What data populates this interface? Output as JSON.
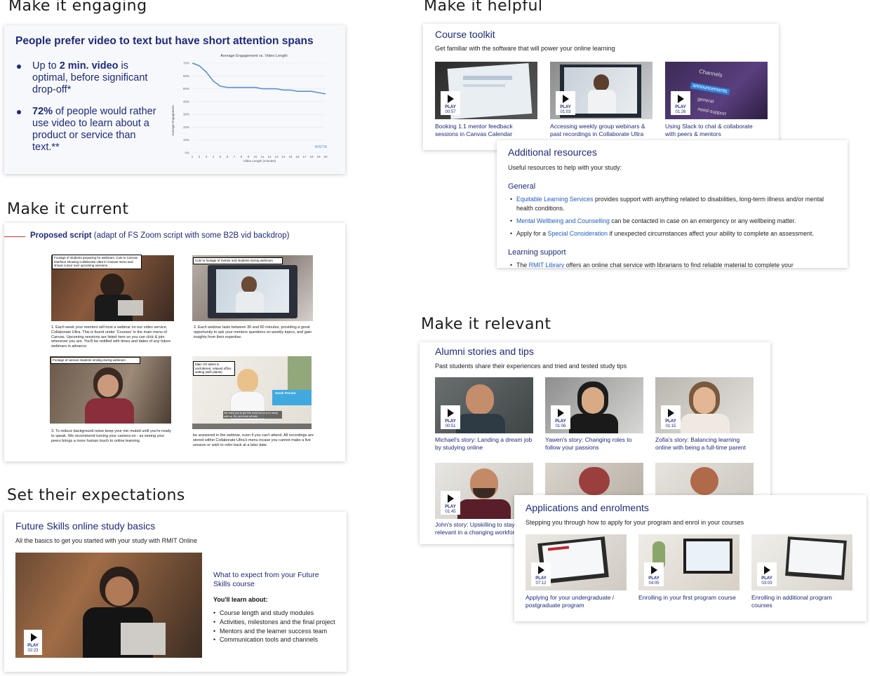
{
  "sections": {
    "engaging": "Make it engaging",
    "current": "Make it current",
    "expectations": "Set their expectations",
    "helpful": "Make it helpful",
    "relevant": "Make it relevant"
  },
  "engaging": {
    "heading": "People prefer video to text but have short attention spans",
    "bullet1_a": "Up to ",
    "bullet1_bold": "2 min. video",
    "bullet1_b": " is optimal, before significant drop-off*",
    "bullet2_bold": "72%",
    "bullet2_b": " of people would rather use video to learn about a product or service than text.**",
    "chart_title": "Average Engagement vs. Video Length",
    "chart_ylabel": "Average Engagement",
    "chart_xlabel": "Video Length (minutes)",
    "chart_brand": "WISTIA"
  },
  "chart_data": {
    "type": "line",
    "title": "Average Engagement vs. Video Length",
    "xlabel": "Video Length (minutes)",
    "ylabel": "Average Engagement",
    "x": [
      1,
      2,
      3,
      4,
      5,
      6,
      7,
      8,
      9,
      10,
      11,
      12,
      13,
      14,
      15,
      16,
      17,
      18,
      19,
      20
    ],
    "y_ticks": [
      "0%",
      "10%",
      "20%",
      "30%",
      "40%",
      "50%",
      "60%",
      "70%"
    ],
    "values": [
      70,
      68,
      63,
      56,
      52,
      51,
      51,
      51,
      51,
      51,
      50,
      50,
      50,
      49,
      49,
      48,
      48,
      48,
      47,
      46
    ],
    "ylim": [
      0,
      70
    ],
    "grid": true,
    "series_color": "#5b8fd6"
  },
  "current": {
    "heading_bold": "Proposed script",
    "heading_rest": " (adapt of FS Zoom script with some B2B vid backdrop)",
    "scenes": [
      {
        "label": "Footage of students preparing for webinars. Cuts to Canvas interface showing Collaborate Ultra in Canvas menu and shows cursor over upcoming sessions.",
        "caption": "1. Each week your mentors will host a webinar on our video service, Collaborate Ultra. This is found under 'Courses' in the main menu of Canvas. Upcoming sessions are listed here so you can click & join whenever you are. You'll be notified with times and dates of any future webinars in advance."
      },
      {
        "label": "Cuts to footage of mentor and students during webinars",
        "caption": "2. Each webinar lasts between 30 and 60 minutes, providing a great opportunity to ask your mentors questions on weekly topics, and gain insights from their expertise."
      },
      {
        "label": "Footage of various students smiling during webinars.",
        "caption": "3. To reduce background noise keep your mic muted until you're ready to speak. We recommend turning your camera on - as seeing your peers brings a more human touch to online learning."
      },
      {
        "label": "Main VO talent in uncluttered, relaxed office setting (with plants)",
        "caption": "be answered in the webinar, even if you can't attend. All recordings are stored within Collaborate Ultra's menu incase you cannot make a live session or wish to refer back at a later date."
      }
    ],
    "vo_name": "Sarah Proctor",
    "vo_subtitle": "We want you to get the most out of your study with us. So, let's kick off with"
  },
  "expectations": {
    "title": "Future Skills online study basics",
    "subtitle": "All the basics to get you started with your study with RMIT Online",
    "video_title": "What to expect from your Future Skills course",
    "learn_heading": "You'll learn about:",
    "learn_items": [
      "Course length and study modules",
      "Activities, milestones and the final project",
      "Mentors and the learner success team",
      "Communication tools and channels"
    ],
    "play_label": "PLAY",
    "duration": "02:23"
  },
  "toolkit": {
    "title": "Course toolkit",
    "subtitle": "Get familiar with the software that will power your online learning",
    "videos": [
      {
        "duration": "00:57",
        "caption": "Booking 1:1 mentor feedback sessions in Canvas Calendar"
      },
      {
        "duration": "01:03",
        "caption": "Accessing weekly group webinars & past recordings in Collaborate Ultra"
      },
      {
        "duration": "01:26",
        "caption": "Using Slack to chat & collaborate with peers & mentors"
      }
    ],
    "slack_channels": "Channels",
    "slack_announcements": "announcements",
    "slack_general": "general",
    "slack_random": "need-support"
  },
  "resources": {
    "title": "Additional resources",
    "subtitle": "Useful resources to help with your study:",
    "general_heading": "General",
    "general_items": [
      {
        "link": "Equitable Learning Services",
        "rest": " provides support with anything related to disabilities, long-term illness and/or mental health conditions."
      },
      {
        "link": "Mental Wellbeing and Counselling",
        "rest": " can be contacted in case on an emergency or any wellbeing matter."
      },
      {
        "pre": "Apply for a ",
        "link": "Special Consideration",
        "rest": " if unexpected circumstances affect your ability to complete an assessment."
      }
    ],
    "learning_heading": "Learning support",
    "learning_pre": "The ",
    "learning_link": "RMIT Library",
    "learning_rest": " offers an online chat service with librarians to find reliable material to complete your"
  },
  "alumni": {
    "title": "Alumni stories and tips",
    "subtitle": "Past students share their experiences and tried and tested study tips",
    "videos": [
      {
        "duration": "00:51",
        "caption": "Michael's story: Landing a dream job by studying online"
      },
      {
        "duration": "01:06",
        "caption": "Yawen's story: Changing roles to follow your passions"
      },
      {
        "duration": "01:15",
        "caption": "Zofia's story: Balancing learning online with being a full-time parent"
      },
      {
        "duration": "01:45",
        "caption": "John's story: Upskilling to stay relevant in a changing workforce"
      }
    ]
  },
  "applications": {
    "title": "Applications and enrolments",
    "subtitle": "Stepping you through how to apply for your program and enrol in your courses",
    "videos": [
      {
        "duration": "07:12",
        "caption": "Applying for your undergraduate / postgraduate program"
      },
      {
        "duration": "04:05",
        "caption": "Enrolling in your first program course"
      },
      {
        "duration": "03:03",
        "caption": "Enrolling in additional program courses"
      }
    ]
  },
  "play_label": "PLAY",
  "colors": {
    "navy": "#1e2a7a",
    "link": "#1f5ec7",
    "accent_red": "#dd3333"
  }
}
